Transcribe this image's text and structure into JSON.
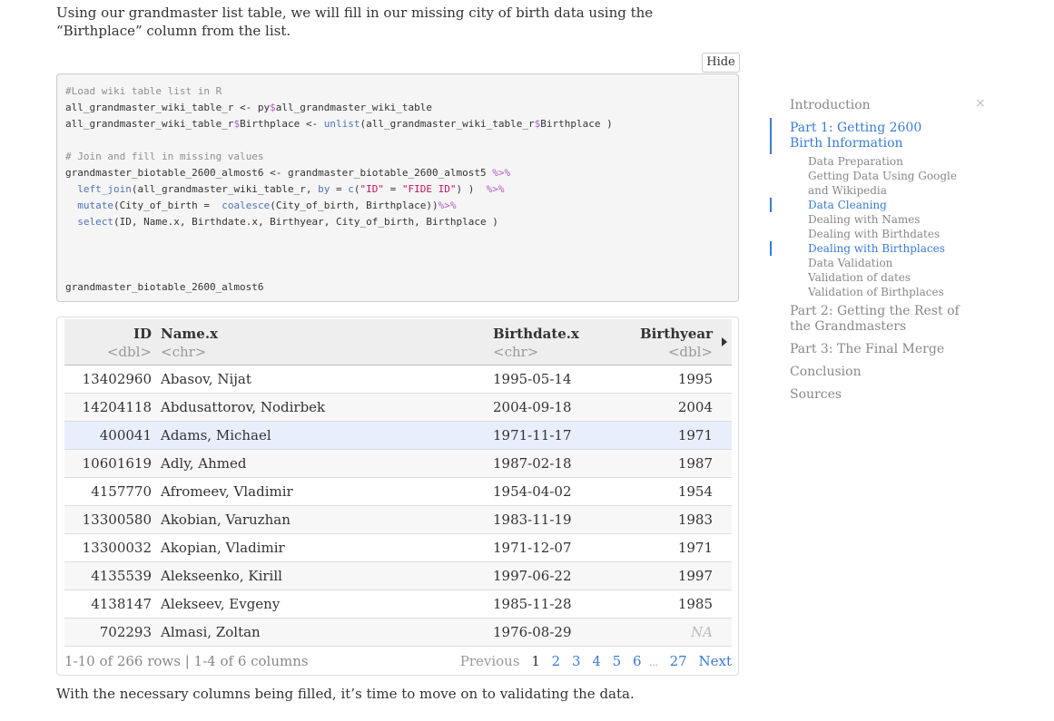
{
  "intro_text": "Using our grandmaster list table, we will fill in our missing city of birth data using the “Birthplace” column from the list.",
  "hide_label": "Hide",
  "code": {
    "c1": "#Load wiki table list in R",
    "l2a": "all_grandmaster_wiki_table_r <- py",
    "l2b": "$",
    "l2c": "all_grandmaster_wiki_table",
    "l3a": "all_grandmaster_wiki_table_r",
    "l3b": "$",
    "l3c": "Birthplace <- ",
    "l3d": "unlist",
    "l3e": "(all_grandmaster_wiki_table_r",
    "l3f": "$",
    "l3g": "Birthplace )",
    "c2": "# Join and fill in missing values",
    "l5a": "grandmaster_biotable_2600_almost6 <- grandmaster_biotable_2600_almost5 ",
    "l5b": "%>%",
    "l6a": "  ",
    "l6b": "left_join",
    "l6c": "(all_grandmaster_wiki_table_r, ",
    "l6d": "by",
    "l6e": " = ",
    "l6f": "c",
    "l6g": "(",
    "l6h": "\"ID\"",
    "l6i": " = ",
    "l6j": "\"FIDE ID\"",
    "l6k": ") )  ",
    "l6l": "%>%",
    "l7a": "  ",
    "l7b": "mutate",
    "l7c": "(City_of_birth =  ",
    "l7d": "coalesce",
    "l7e": "(City_of_birth, Birthplace))",
    "l7f": "%>%",
    "l8a": "  ",
    "l8b": "select",
    "l8c": "(ID, Name.x, Birthdate.x, Birthyear, City_of_birth, Birthplace )",
    "l12": "grandmaster_biotable_2600_almost6"
  },
  "table": {
    "columns": [
      {
        "name": "ID",
        "type": "<dbl>"
      },
      {
        "name": "Name.x",
        "type": "<chr>"
      },
      {
        "name": "Birthdate.x",
        "type": "<chr>"
      },
      {
        "name": "Birthyear",
        "type": "<dbl>"
      }
    ],
    "rows": [
      {
        "id": "13402960",
        "name": "Abasov, Nijat",
        "date": "1995-05-14",
        "year": "1995"
      },
      {
        "id": "14204118",
        "name": "Abdusattorov, Nodirbek",
        "date": "2004-09-18",
        "year": "2004"
      },
      {
        "id": "400041",
        "name": "Adams, Michael",
        "date": "1971-11-17",
        "year": "1971"
      },
      {
        "id": "10601619",
        "name": "Adly, Ahmed",
        "date": "1987-02-18",
        "year": "1987"
      },
      {
        "id": "4157770",
        "name": "Afromeev, Vladimir",
        "date": "1954-04-02",
        "year": "1954"
      },
      {
        "id": "13300580",
        "name": "Akobian, Varuzhan",
        "date": "1983-11-19",
        "year": "1983"
      },
      {
        "id": "13300032",
        "name": "Akopian, Vladimir",
        "date": "1971-12-07",
        "year": "1971"
      },
      {
        "id": "4135539",
        "name": "Alekseenko, Kirill",
        "date": "1997-06-22",
        "year": "1997"
      },
      {
        "id": "4138147",
        "name": "Alekseev, Evgeny",
        "date": "1985-11-28",
        "year": "1985"
      },
      {
        "id": "702293",
        "name": "Almasi, Zoltan",
        "date": "1976-08-29",
        "year": "NA"
      }
    ],
    "row_info": "1-10 of 266 rows | 1-4 of 6 columns",
    "pager": {
      "previous": "Previous",
      "pages": [
        "1",
        "2",
        "3",
        "4",
        "5",
        "6"
      ],
      "ellipsis": "...",
      "last": "27",
      "next": "Next",
      "current": "1"
    }
  },
  "outro_text": "With the necessary columns being filled, it’s time to move on to validating the data.",
  "toc": {
    "close": "×",
    "items": [
      {
        "label": "Introduction"
      },
      {
        "label": "Part 1: Getting 2600 Birth Information",
        "active": true
      },
      {
        "label": "Data Preparation"
      },
      {
        "label": "Getting Data Using Google and Wikipedia"
      },
      {
        "label": "Data Cleaning",
        "active": true
      },
      {
        "label": "Dealing with Names"
      },
      {
        "label": "Dealing with Birthdates"
      },
      {
        "label": "Dealing with Birthplaces",
        "active": true
      },
      {
        "label": "Data Validation"
      },
      {
        "label": "Validation of dates"
      },
      {
        "label": "Validation of Birthplaces"
      },
      {
        "label": "Part 2: Getting the Rest of the Grandmasters"
      },
      {
        "label": "Part 3: The Final Merge"
      },
      {
        "label": "Conclusion"
      },
      {
        "label": "Sources"
      }
    ]
  },
  "colors": {
    "accent": "#3a7bd5",
    "highlight_row": "#e8eefc"
  }
}
